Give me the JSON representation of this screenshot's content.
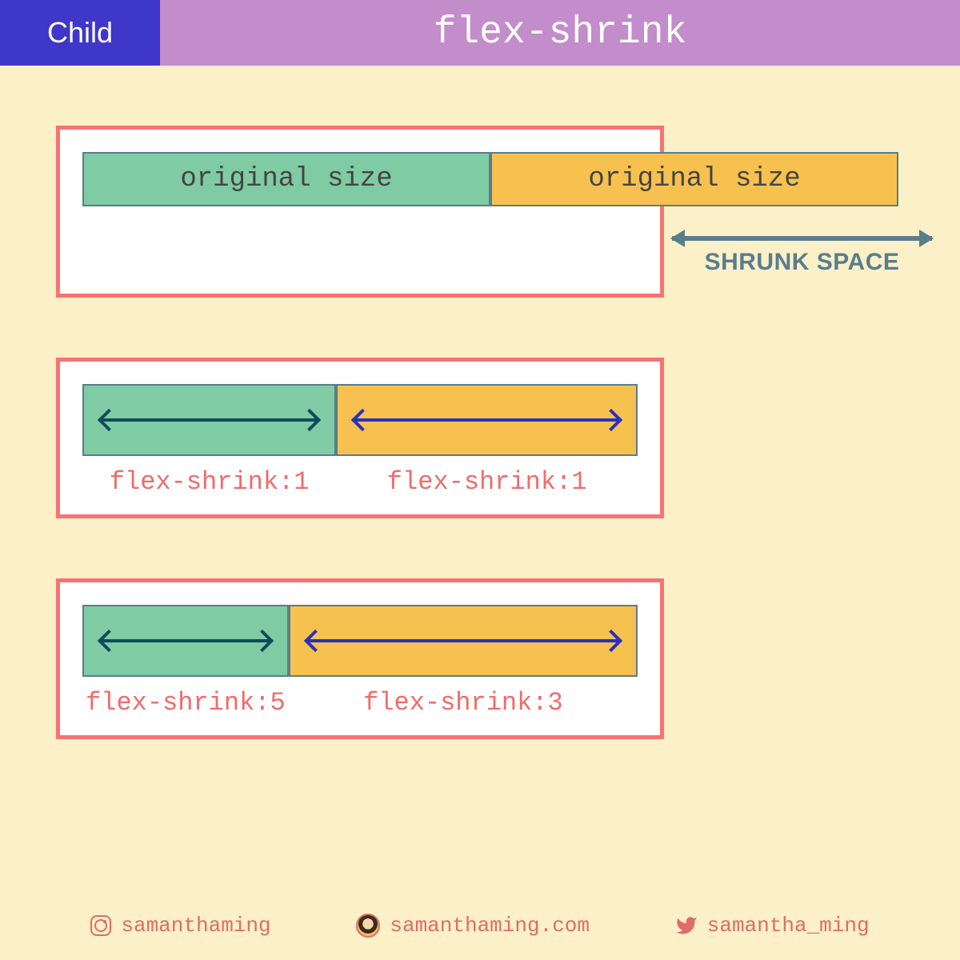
{
  "header": {
    "tag": "Child",
    "title": "flex-shrink"
  },
  "colors": {
    "header_tag_bg": "#3F37C9",
    "header_title_bg": "#C38CCB",
    "page_bg": "#FBF0C8",
    "frame_border": "#F77373",
    "box_border": "#5A7D8C",
    "box_green": "#7FCBA4",
    "box_yellow": "#F6C14E",
    "label_red": "#F26B6B",
    "arrow_dark": "#0E4B5A",
    "arrow_blue": "#2B2FBF"
  },
  "example1": {
    "box_a": "original size",
    "box_b": "original size",
    "overflow_label": "SHRUNK SPACE"
  },
  "example2": {
    "label_a": "flex-shrink:1",
    "label_b": "flex-shrink:1"
  },
  "example3": {
    "label_a": "flex-shrink:5",
    "label_b": "flex-shrink:3"
  },
  "footer": {
    "instagram": "samanthaming",
    "website": "samanthaming.com",
    "twitter": "samantha_ming"
  }
}
